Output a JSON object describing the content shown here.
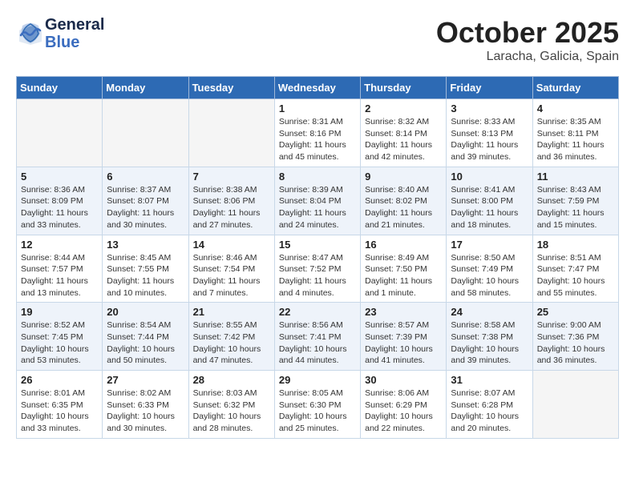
{
  "header": {
    "logo_line1": "General",
    "logo_line2": "Blue",
    "month": "October 2025",
    "location": "Laracha, Galicia, Spain"
  },
  "weekdays": [
    "Sunday",
    "Monday",
    "Tuesday",
    "Wednesday",
    "Thursday",
    "Friday",
    "Saturday"
  ],
  "weeks": [
    [
      {
        "day": "",
        "info": ""
      },
      {
        "day": "",
        "info": ""
      },
      {
        "day": "",
        "info": ""
      },
      {
        "day": "1",
        "info": "Sunrise: 8:31 AM\nSunset: 8:16 PM\nDaylight: 11 hours\nand 45 minutes."
      },
      {
        "day": "2",
        "info": "Sunrise: 8:32 AM\nSunset: 8:14 PM\nDaylight: 11 hours\nand 42 minutes."
      },
      {
        "day": "3",
        "info": "Sunrise: 8:33 AM\nSunset: 8:13 PM\nDaylight: 11 hours\nand 39 minutes."
      },
      {
        "day": "4",
        "info": "Sunrise: 8:35 AM\nSunset: 8:11 PM\nDaylight: 11 hours\nand 36 minutes."
      }
    ],
    [
      {
        "day": "5",
        "info": "Sunrise: 8:36 AM\nSunset: 8:09 PM\nDaylight: 11 hours\nand 33 minutes."
      },
      {
        "day": "6",
        "info": "Sunrise: 8:37 AM\nSunset: 8:07 PM\nDaylight: 11 hours\nand 30 minutes."
      },
      {
        "day": "7",
        "info": "Sunrise: 8:38 AM\nSunset: 8:06 PM\nDaylight: 11 hours\nand 27 minutes."
      },
      {
        "day": "8",
        "info": "Sunrise: 8:39 AM\nSunset: 8:04 PM\nDaylight: 11 hours\nand 24 minutes."
      },
      {
        "day": "9",
        "info": "Sunrise: 8:40 AM\nSunset: 8:02 PM\nDaylight: 11 hours\nand 21 minutes."
      },
      {
        "day": "10",
        "info": "Sunrise: 8:41 AM\nSunset: 8:00 PM\nDaylight: 11 hours\nand 18 minutes."
      },
      {
        "day": "11",
        "info": "Sunrise: 8:43 AM\nSunset: 7:59 PM\nDaylight: 11 hours\nand 15 minutes."
      }
    ],
    [
      {
        "day": "12",
        "info": "Sunrise: 8:44 AM\nSunset: 7:57 PM\nDaylight: 11 hours\nand 13 minutes."
      },
      {
        "day": "13",
        "info": "Sunrise: 8:45 AM\nSunset: 7:55 PM\nDaylight: 11 hours\nand 10 minutes."
      },
      {
        "day": "14",
        "info": "Sunrise: 8:46 AM\nSunset: 7:54 PM\nDaylight: 11 hours\nand 7 minutes."
      },
      {
        "day": "15",
        "info": "Sunrise: 8:47 AM\nSunset: 7:52 PM\nDaylight: 11 hours\nand 4 minutes."
      },
      {
        "day": "16",
        "info": "Sunrise: 8:49 AM\nSunset: 7:50 PM\nDaylight: 11 hours\nand 1 minute."
      },
      {
        "day": "17",
        "info": "Sunrise: 8:50 AM\nSunset: 7:49 PM\nDaylight: 10 hours\nand 58 minutes."
      },
      {
        "day": "18",
        "info": "Sunrise: 8:51 AM\nSunset: 7:47 PM\nDaylight: 10 hours\nand 55 minutes."
      }
    ],
    [
      {
        "day": "19",
        "info": "Sunrise: 8:52 AM\nSunset: 7:45 PM\nDaylight: 10 hours\nand 53 minutes."
      },
      {
        "day": "20",
        "info": "Sunrise: 8:54 AM\nSunset: 7:44 PM\nDaylight: 10 hours\nand 50 minutes."
      },
      {
        "day": "21",
        "info": "Sunrise: 8:55 AM\nSunset: 7:42 PM\nDaylight: 10 hours\nand 47 minutes."
      },
      {
        "day": "22",
        "info": "Sunrise: 8:56 AM\nSunset: 7:41 PM\nDaylight: 10 hours\nand 44 minutes."
      },
      {
        "day": "23",
        "info": "Sunrise: 8:57 AM\nSunset: 7:39 PM\nDaylight: 10 hours\nand 41 minutes."
      },
      {
        "day": "24",
        "info": "Sunrise: 8:58 AM\nSunset: 7:38 PM\nDaylight: 10 hours\nand 39 minutes."
      },
      {
        "day": "25",
        "info": "Sunrise: 9:00 AM\nSunset: 7:36 PM\nDaylight: 10 hours\nand 36 minutes."
      }
    ],
    [
      {
        "day": "26",
        "info": "Sunrise: 8:01 AM\nSunset: 6:35 PM\nDaylight: 10 hours\nand 33 minutes."
      },
      {
        "day": "27",
        "info": "Sunrise: 8:02 AM\nSunset: 6:33 PM\nDaylight: 10 hours\nand 30 minutes."
      },
      {
        "day": "28",
        "info": "Sunrise: 8:03 AM\nSunset: 6:32 PM\nDaylight: 10 hours\nand 28 minutes."
      },
      {
        "day": "29",
        "info": "Sunrise: 8:05 AM\nSunset: 6:30 PM\nDaylight: 10 hours\nand 25 minutes."
      },
      {
        "day": "30",
        "info": "Sunrise: 8:06 AM\nSunset: 6:29 PM\nDaylight: 10 hours\nand 22 minutes."
      },
      {
        "day": "31",
        "info": "Sunrise: 8:07 AM\nSunset: 6:28 PM\nDaylight: 10 hours\nand 20 minutes."
      },
      {
        "day": "",
        "info": ""
      }
    ]
  ]
}
